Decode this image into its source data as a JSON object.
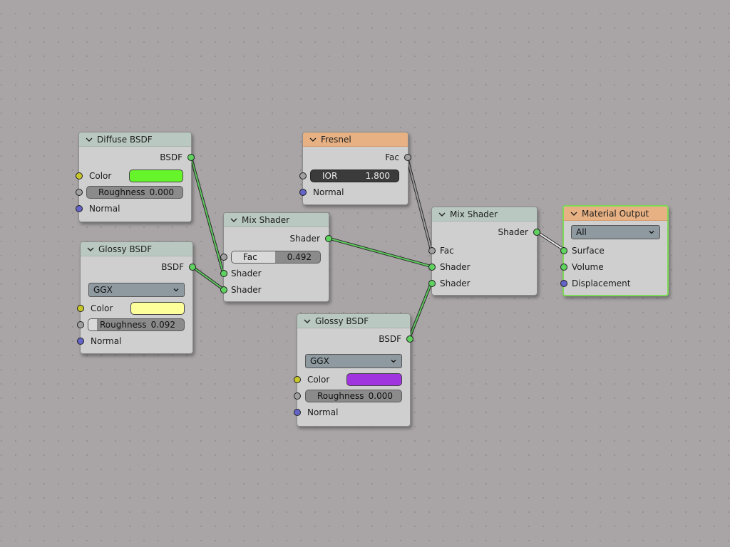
{
  "nodes": {
    "diffuse": {
      "title": "Diffuse BSDF",
      "output": "BSDF",
      "color_label": "Color",
      "color_value": "#66f52a",
      "roughness_label": "Roughness",
      "roughness_value": "0.000",
      "roughness_fraction": 0.0,
      "normal_label": "Normal"
    },
    "glossy1": {
      "title": "Glossy BSDF",
      "output": "BSDF",
      "distribution": "GGX",
      "color_label": "Color",
      "color_value": "#fdff9b",
      "roughness_label": "Roughness",
      "roughness_value": "0.092",
      "roughness_fraction": 0.092,
      "normal_label": "Normal"
    },
    "fresnel": {
      "title": "Fresnel",
      "output": "Fac",
      "ior_label": "IOR",
      "ior_value": "1.800",
      "normal_label": "Normal"
    },
    "mix1": {
      "title": "Mix Shader",
      "output": "Shader",
      "fac_label": "Fac",
      "fac_value": "0.492",
      "fac_fraction": 0.492,
      "shader_a": "Shader",
      "shader_b": "Shader"
    },
    "glossy2": {
      "title": "Glossy BSDF",
      "output": "BSDF",
      "distribution": "GGX",
      "color_label": "Color",
      "color_value": "#a035e0",
      "roughness_label": "Roughness",
      "roughness_value": "0.000",
      "roughness_fraction": 0.0,
      "normal_label": "Normal"
    },
    "mix2": {
      "title": "Mix Shader",
      "output": "Shader",
      "fac_label": "Fac",
      "shader_a": "Shader",
      "shader_b": "Shader"
    },
    "output": {
      "title": "Material Output",
      "target": "All",
      "surface_label": "Surface",
      "volume_label": "Volume",
      "displacement_label": "Displacement"
    }
  },
  "colors": {
    "header_shader": "#b9c9c1",
    "header_input_output": "#e7b184",
    "socket_shader": "#5fd25f",
    "socket_color": "#c7c72b",
    "socket_float": "#a0a0a0",
    "socket_vector": "#6464c8",
    "selection": "#7ed957",
    "link_shader": "#2f7d2f"
  }
}
